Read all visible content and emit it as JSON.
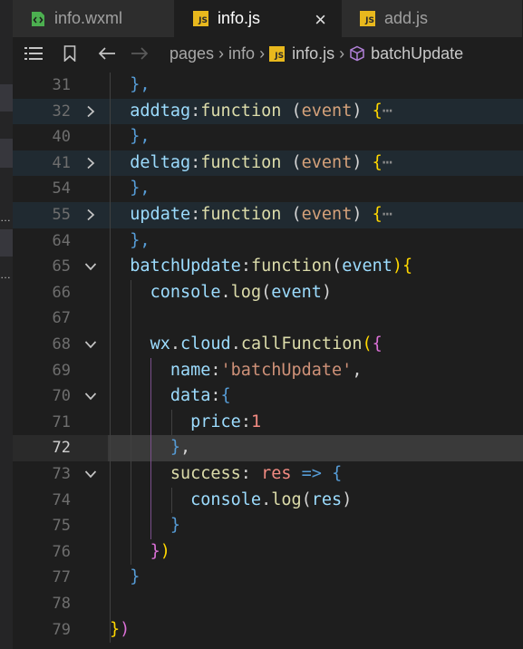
{
  "tabs": [
    {
      "label": "info.wxml",
      "icon": "wxml-file-icon",
      "active": false
    },
    {
      "label": "info.js",
      "icon": "js-file-icon",
      "active": true,
      "close": "×"
    },
    {
      "label": "add.js",
      "icon": "js-file-icon",
      "active": false
    }
  ],
  "js_badge": "JS",
  "breadcrumb": {
    "items": [
      "pages",
      "info",
      "info.js",
      "batchUpdate"
    ]
  },
  "colors": {
    "accent_yellow": "#e8b81d",
    "wxml_green": "#4caf50",
    "current_line": "#3a3a3a"
  },
  "editor": {
    "current_line": "72",
    "lines": [
      {
        "no": "31",
        "fold": "",
        "tokens": [
          [
            "  ",
            "plain"
          ],
          [
            "},",
            "brace-b"
          ]
        ]
      },
      {
        "no": "32",
        "fold": "collapsed",
        "tokens": [
          [
            "  ",
            "plain"
          ],
          [
            "addtag",
            "prop"
          ],
          [
            ":",
            "plain"
          ],
          [
            "function",
            "kw-func"
          ],
          [
            " ",
            "plain"
          ],
          [
            "(",
            "paren"
          ],
          [
            "event",
            "event-dim"
          ],
          [
            ")",
            "paren"
          ],
          [
            " ",
            "plain"
          ],
          [
            "{",
            "brace-y"
          ],
          [
            "⋯",
            "ellipsis"
          ]
        ]
      },
      {
        "no": "40",
        "fold": "",
        "tokens": [
          [
            "  ",
            "plain"
          ],
          [
            "},",
            "brace-b"
          ]
        ]
      },
      {
        "no": "41",
        "fold": "collapsed",
        "tokens": [
          [
            "  ",
            "plain"
          ],
          [
            "deltag",
            "prop"
          ],
          [
            ":",
            "plain"
          ],
          [
            "function",
            "kw-func"
          ],
          [
            " ",
            "plain"
          ],
          [
            "(",
            "paren"
          ],
          [
            "event",
            "event-dim"
          ],
          [
            ")",
            "paren"
          ],
          [
            " ",
            "plain"
          ],
          [
            "{",
            "brace-y"
          ],
          [
            "⋯",
            "ellipsis"
          ]
        ]
      },
      {
        "no": "54",
        "fold": "",
        "tokens": [
          [
            "  ",
            "plain"
          ],
          [
            "},",
            "brace-b"
          ]
        ]
      },
      {
        "no": "55",
        "fold": "collapsed",
        "tokens": [
          [
            "  ",
            "plain"
          ],
          [
            "update",
            "prop"
          ],
          [
            ":",
            "plain"
          ],
          [
            "function",
            "kw-func"
          ],
          [
            " ",
            "plain"
          ],
          [
            "(",
            "paren"
          ],
          [
            "event",
            "event-dim"
          ],
          [
            ")",
            "paren"
          ],
          [
            " ",
            "plain"
          ],
          [
            "{",
            "brace-y"
          ],
          [
            "⋯",
            "ellipsis"
          ]
        ]
      },
      {
        "no": "64",
        "fold": "",
        "tokens": [
          [
            "  ",
            "plain"
          ],
          [
            "},",
            "brace-b"
          ]
        ]
      },
      {
        "no": "65",
        "fold": "expanded",
        "tokens": [
          [
            "  ",
            "plain"
          ],
          [
            "batchUpdate",
            "prop"
          ],
          [
            ":",
            "plain"
          ],
          [
            "function",
            "kw-func"
          ],
          [
            "(",
            "paren"
          ],
          [
            "event",
            "prop"
          ],
          [
            "){",
            "brace-y"
          ]
        ]
      },
      {
        "no": "66",
        "fold": "",
        "tokens": [
          [
            "    ",
            "plain"
          ],
          [
            "console",
            "prop"
          ],
          [
            ".",
            "plain"
          ],
          [
            "log",
            "method"
          ],
          [
            "(",
            "paren"
          ],
          [
            "event",
            "prop"
          ],
          [
            ")",
            "paren"
          ]
        ]
      },
      {
        "no": "67",
        "fold": "",
        "tokens": []
      },
      {
        "no": "68",
        "fold": "expanded",
        "tokens": [
          [
            "    ",
            "plain"
          ],
          [
            "wx",
            "prop"
          ],
          [
            ".",
            "plain"
          ],
          [
            "cloud",
            "prop"
          ],
          [
            ".",
            "plain"
          ],
          [
            "callFunction",
            "method"
          ],
          [
            "(",
            "brace-y"
          ],
          [
            "{",
            "brace-p"
          ]
        ]
      },
      {
        "no": "69",
        "fold": "",
        "tokens": [
          [
            "      ",
            "plain"
          ],
          [
            "name",
            "prop"
          ],
          [
            ":",
            "plain"
          ],
          [
            "'batchUpdate'",
            "str"
          ],
          [
            ",",
            "plain"
          ]
        ]
      },
      {
        "no": "70",
        "fold": "expanded",
        "tokens": [
          [
            "      ",
            "plain"
          ],
          [
            "data",
            "prop"
          ],
          [
            ":",
            "plain"
          ],
          [
            "{",
            "brace-b"
          ]
        ]
      },
      {
        "no": "71",
        "fold": "",
        "tokens": [
          [
            "        ",
            "plain"
          ],
          [
            "price",
            "prop"
          ],
          [
            ":",
            "plain"
          ],
          [
            "1",
            "res"
          ]
        ]
      },
      {
        "no": "72",
        "fold": "",
        "tokens": [
          [
            "      ",
            "plain"
          ],
          [
            "}",
            "brace-b"
          ],
          [
            ",",
            "plain"
          ]
        ]
      },
      {
        "no": "73",
        "fold": "expanded",
        "tokens": [
          [
            "      ",
            "plain"
          ],
          [
            "success",
            "success"
          ],
          [
            ": ",
            "plain"
          ],
          [
            "res",
            "res"
          ],
          [
            " ",
            "plain"
          ],
          [
            "=>",
            "arrow"
          ],
          [
            " ",
            "plain"
          ],
          [
            "{",
            "brace-b"
          ]
        ]
      },
      {
        "no": "74",
        "fold": "",
        "tokens": [
          [
            "        ",
            "plain"
          ],
          [
            "console",
            "prop"
          ],
          [
            ".",
            "plain"
          ],
          [
            "log",
            "method"
          ],
          [
            "(",
            "paren"
          ],
          [
            "res",
            "prop"
          ],
          [
            ")",
            "paren"
          ]
        ]
      },
      {
        "no": "75",
        "fold": "",
        "tokens": [
          [
            "      ",
            "plain"
          ],
          [
            "}",
            "brace-b"
          ]
        ]
      },
      {
        "no": "76",
        "fold": "",
        "tokens": [
          [
            "    ",
            "plain"
          ],
          [
            "}",
            "brace-p"
          ],
          [
            ")",
            "brace-y"
          ]
        ]
      },
      {
        "no": "77",
        "fold": "",
        "tokens": [
          [
            "  ",
            "plain"
          ],
          [
            "}",
            "brace-b"
          ]
        ]
      },
      {
        "no": "78",
        "fold": "",
        "tokens": []
      },
      {
        "no": "79",
        "fold": "",
        "tokens": [
          [
            "}",
            "brace-y"
          ],
          [
            ")",
            "brace-p"
          ]
        ]
      }
    ]
  }
}
